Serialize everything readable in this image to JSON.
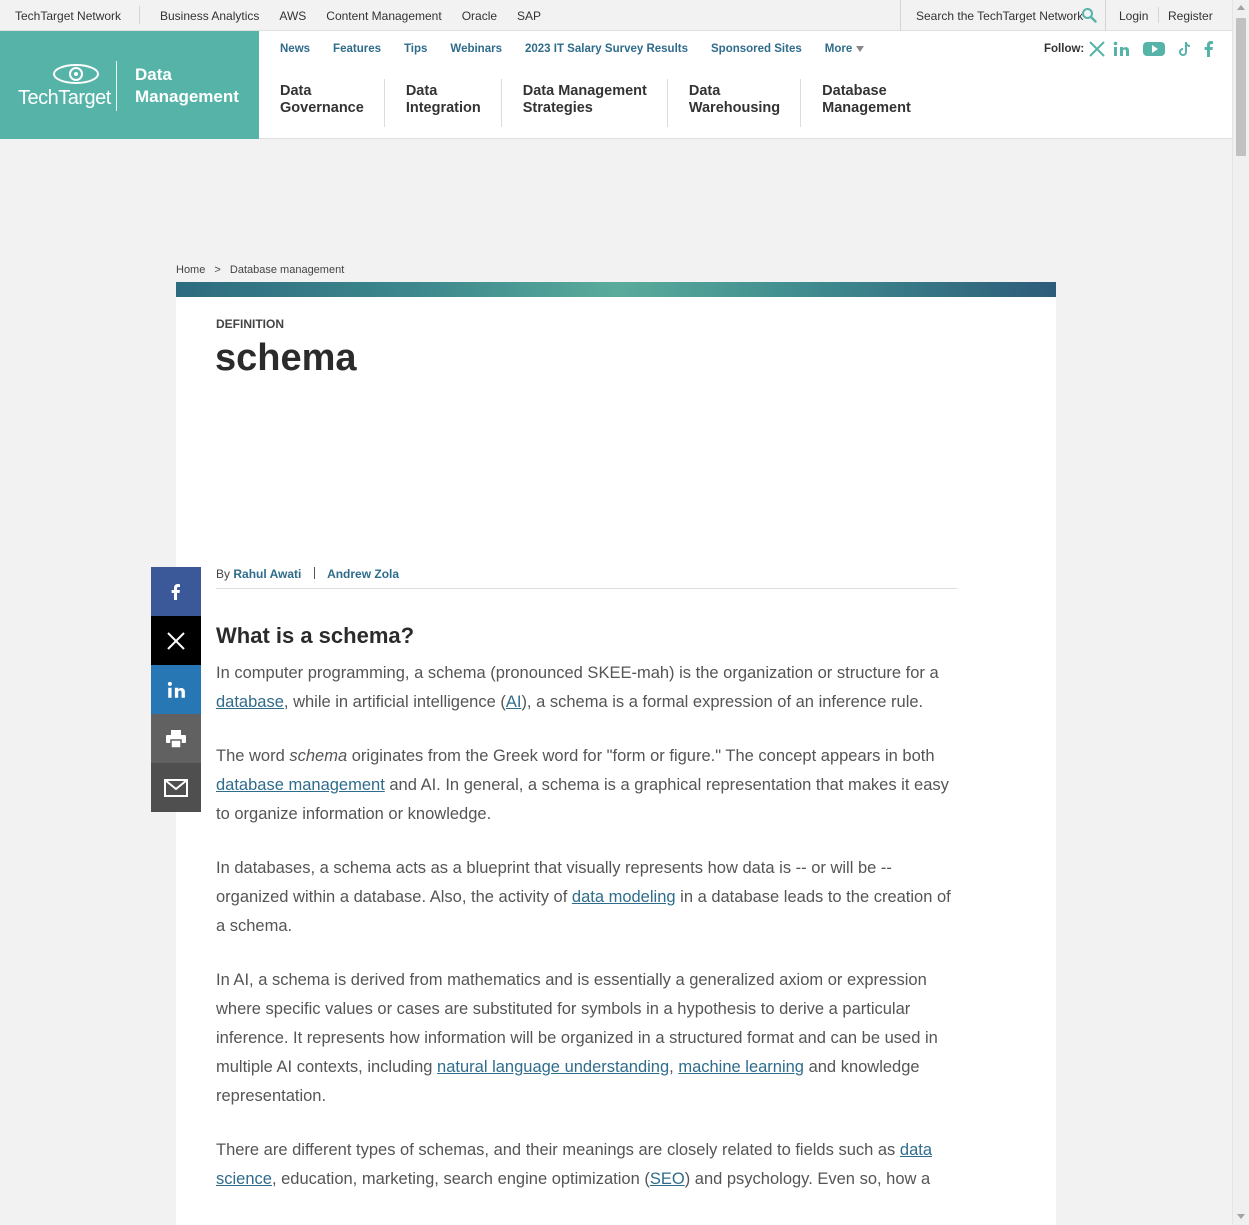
{
  "network_bar": {
    "brand": "TechTarget Network",
    "sites": [
      "Business Analytics",
      "AWS",
      "Content Management",
      "Oracle",
      "SAP"
    ],
    "search_placeholder": "Search the TechTarget Network",
    "login": "Login",
    "register": "Register"
  },
  "header": {
    "logo_text": "TechTarget",
    "site_name_line1": "Data",
    "site_name_line2": "Management",
    "subnav": [
      "News",
      "Features",
      "Tips",
      "Webinars",
      "2023 IT Salary Survey Results",
      "Sponsored Sites",
      "More"
    ],
    "follow_label": "Follow:",
    "topics": [
      {
        "line1": "Data",
        "line2": "Governance"
      },
      {
        "line1": "Data",
        "line2": "Integration"
      },
      {
        "line1": "Data Management",
        "line2": "Strategies"
      },
      {
        "line1": "Data",
        "line2": "Warehousing"
      },
      {
        "line1": "Database",
        "line2": "Management"
      }
    ],
    "accent_color": "#55b3a8"
  },
  "breadcrumb": {
    "home": "Home",
    "separator": ">",
    "current": "Database management"
  },
  "article": {
    "label": "DEFINITION",
    "title": "schema",
    "by": "By",
    "authors": [
      "Rahul Awati",
      "Andrew Zola"
    ],
    "heading": "What is a schema?",
    "p1": {
      "t1": "In computer programming, a schema (pronounced SKEE-mah) is the organization or structure for a ",
      "l1": "database",
      "t2": ", while in artificial intelligence (",
      "l2": "AI",
      "t3": "), a schema is a formal expression of an inference rule."
    },
    "p2": {
      "t1": "The word ",
      "em": "schema",
      "t2": " originates from the Greek word for \"form or figure.\" The concept appears in both ",
      "l1": "database management",
      "t3": " and AI. In general, a schema is a graphical representation that makes it easy to organize information or knowledge."
    },
    "p3": {
      "t1": "In databases, a schema acts as a blueprint that visually represents how data is -- or will be -- organized within a database. Also, the activity of ",
      "l1": "data modeling",
      "t2": " in a database leads to the creation of a schema."
    },
    "p4": {
      "t1": "In AI, a schema is derived from mathematics and is essentially a generalized axiom or expression where specific values or cases are substituted for symbols in a hypothesis to derive a particular inference. It represents how information will be organized in a structured format and can be used in multiple AI contexts, including ",
      "l1": "natural language understanding",
      "t2": ", ",
      "l2": "machine learning",
      "t3": " and knowledge representation."
    },
    "p5": {
      "t1": "There are different types of schemas, and their meanings are closely related to fields such as ",
      "l1": "data science",
      "t2": ", education, marketing, search engine optimization (",
      "l2": "SEO",
      "t3": ") and psychology. Even so, how a"
    }
  },
  "share": [
    "facebook-icon",
    "x-icon",
    "linkedin-icon",
    "print-icon",
    "email-icon"
  ]
}
